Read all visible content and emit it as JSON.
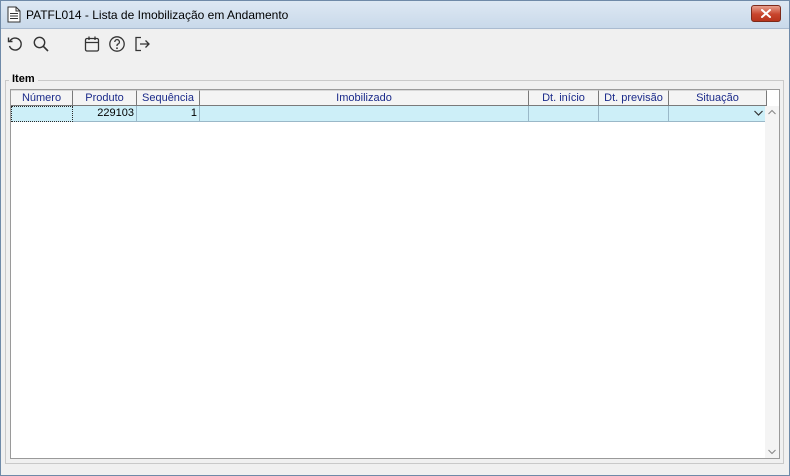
{
  "window": {
    "title": "PATFL014 - Lista de Imobilização em Andamento"
  },
  "toolbar": {
    "buttons": [
      {
        "icon": "refresh-icon"
      },
      {
        "icon": "search-icon"
      },
      {
        "icon": "calendar-icon"
      },
      {
        "icon": "help-icon"
      },
      {
        "icon": "exit-icon"
      }
    ]
  },
  "group": {
    "label": "Item"
  },
  "table": {
    "columns": [
      "Número",
      "Produto",
      "Sequência",
      "Imobilizado",
      "Dt. início",
      "Dt. previsão",
      "Situação"
    ],
    "rows": [
      {
        "numero": "",
        "produto": "229103",
        "sequencia": "1",
        "imobilizado": "",
        "dt_inicio": "",
        "dt_previsao": "",
        "situacao": ""
      }
    ]
  },
  "colors": {
    "header_text": "#1a2a8a",
    "row_highlight": "#cdeff8",
    "close_button": "#c8452c"
  }
}
